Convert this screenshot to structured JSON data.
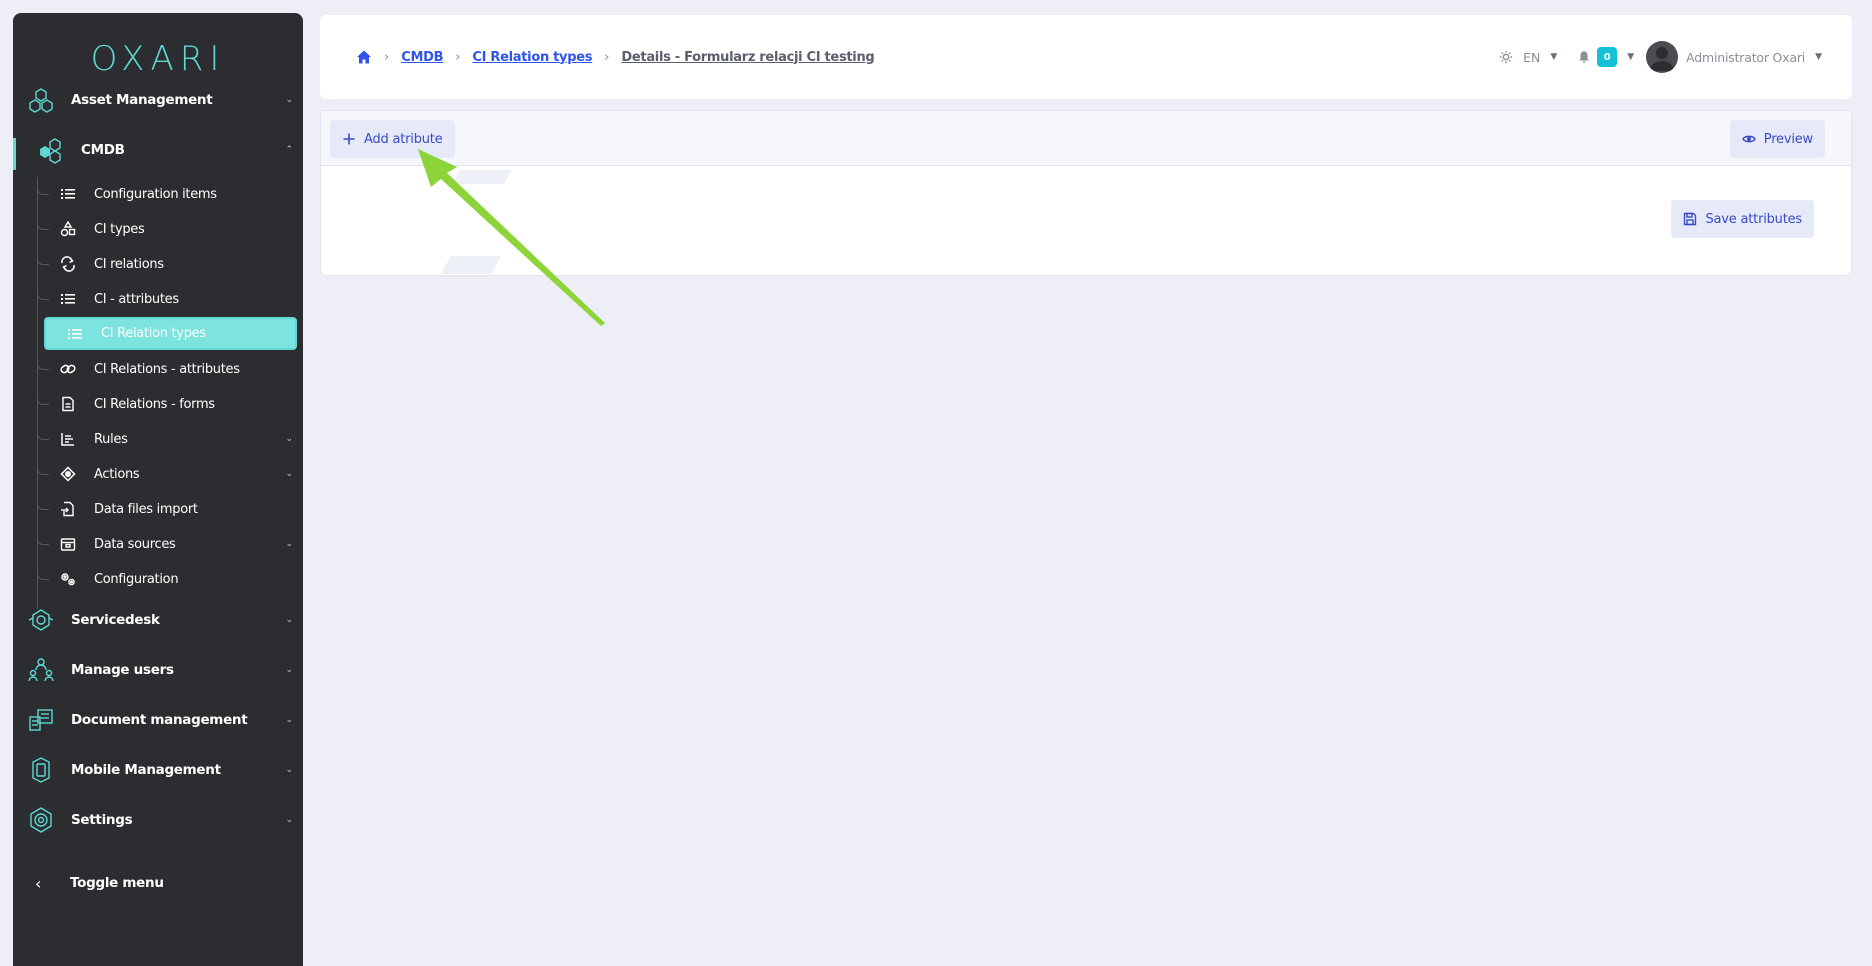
{
  "sidebar": {
    "logo": "OXARI",
    "sections": [
      {
        "label": "Asset Management",
        "icon": "asset-management-icon",
        "chevron": "⌄"
      },
      {
        "label": "CMDB",
        "icon": "cmdb-icon",
        "chevron": "⌃"
      },
      {
        "label": "Servicedesk",
        "icon": "servicedesk-icon",
        "chevron": "⌄"
      },
      {
        "label": "Manage users",
        "icon": "users-icon",
        "chevron": "⌄"
      },
      {
        "label": "Document management",
        "icon": "document-icon",
        "chevron": "⌄"
      },
      {
        "label": "Mobile Management",
        "icon": "mobile-icon",
        "chevron": "⌄"
      },
      {
        "label": "Settings",
        "icon": "settings-icon",
        "chevron": "⌄"
      }
    ],
    "cmdb_items": [
      {
        "label": "Configuration items",
        "icon": "list-icon"
      },
      {
        "label": "CI types",
        "icon": "shapes-icon"
      },
      {
        "label": "CI relations",
        "icon": "swap-icon"
      },
      {
        "label": "CI - attributes",
        "icon": "list-icon"
      },
      {
        "label": "CI Relation types",
        "icon": "list-icon"
      },
      {
        "label": "CI Relations - attributes",
        "icon": "link-icon"
      },
      {
        "label": "CI Relations - forms",
        "icon": "file-icon"
      },
      {
        "label": "Rules",
        "icon": "chart-icon",
        "chevron": "⌄"
      },
      {
        "label": "Actions",
        "icon": "target-icon",
        "chevron": "⌄"
      },
      {
        "label": "Data files import",
        "icon": "file-import-icon"
      },
      {
        "label": "Data sources",
        "icon": "box-icon",
        "chevron": "⌄"
      },
      {
        "label": "Configuration",
        "icon": "cogs-icon"
      }
    ],
    "toggle_label": "Toggle menu"
  },
  "header": {
    "breadcrumbs": [
      "CMDB",
      "CI Relation types"
    ],
    "current": "Details - Formularz relacji CI testing",
    "language": "EN",
    "notifications": "0",
    "user": "Administrator Oxari"
  },
  "toolbar": {
    "add_label": "Add atribute",
    "preview_label": "Preview"
  },
  "content": {
    "save_label": "Save attributes"
  },
  "colors": {
    "accent": "#5fd8d2",
    "link": "#2f54eb",
    "sidebar_bg": "#2b2d31",
    "arrow": "#8dd33a"
  }
}
